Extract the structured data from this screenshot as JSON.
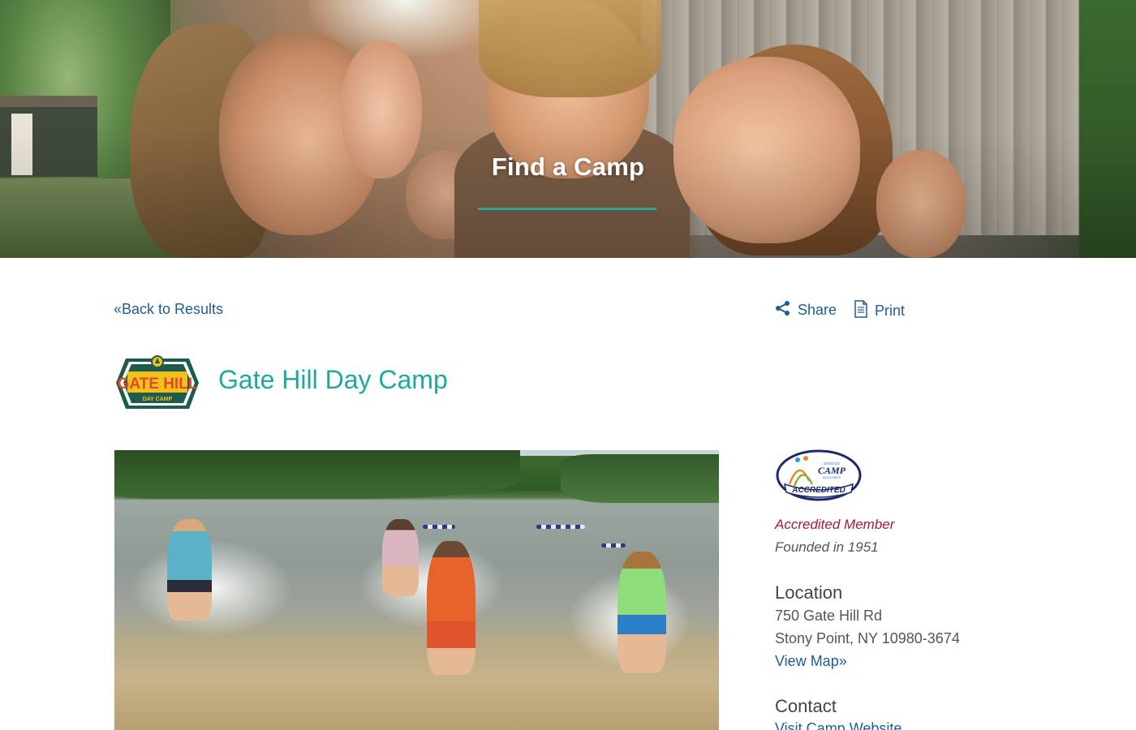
{
  "hero": {
    "title": "Find a Camp",
    "accent_color": "#2aa79b"
  },
  "nav": {
    "back_label": "«Back to Results",
    "share_label": "Share",
    "print_label": "Print",
    "link_color": "#1f5d93"
  },
  "camp": {
    "name": "Gate Hill Day Camp",
    "logo": {
      "line1": "GATE HILL",
      "line2": "DAY CAMP"
    },
    "title_color": "#1ea99b"
  },
  "sidebar": {
    "badge": {
      "org_small": "american",
      "org_big": "CAMP",
      "org_small2": "association",
      "label": "ACCREDITED"
    },
    "accredited_text": "Accredited Member",
    "accredited_color": "#a5193a",
    "founded_text": "Founded in 1951",
    "location_heading": "Location",
    "address_line1": "750 Gate Hill Rd",
    "address_line2": "Stony Point, NY 10980-3674",
    "view_map_label": "View Map»",
    "contact_heading": "Contact",
    "visit_site_label": "Visit Camp Website"
  },
  "icons": {
    "share": "share-icon",
    "print": "print-icon"
  }
}
